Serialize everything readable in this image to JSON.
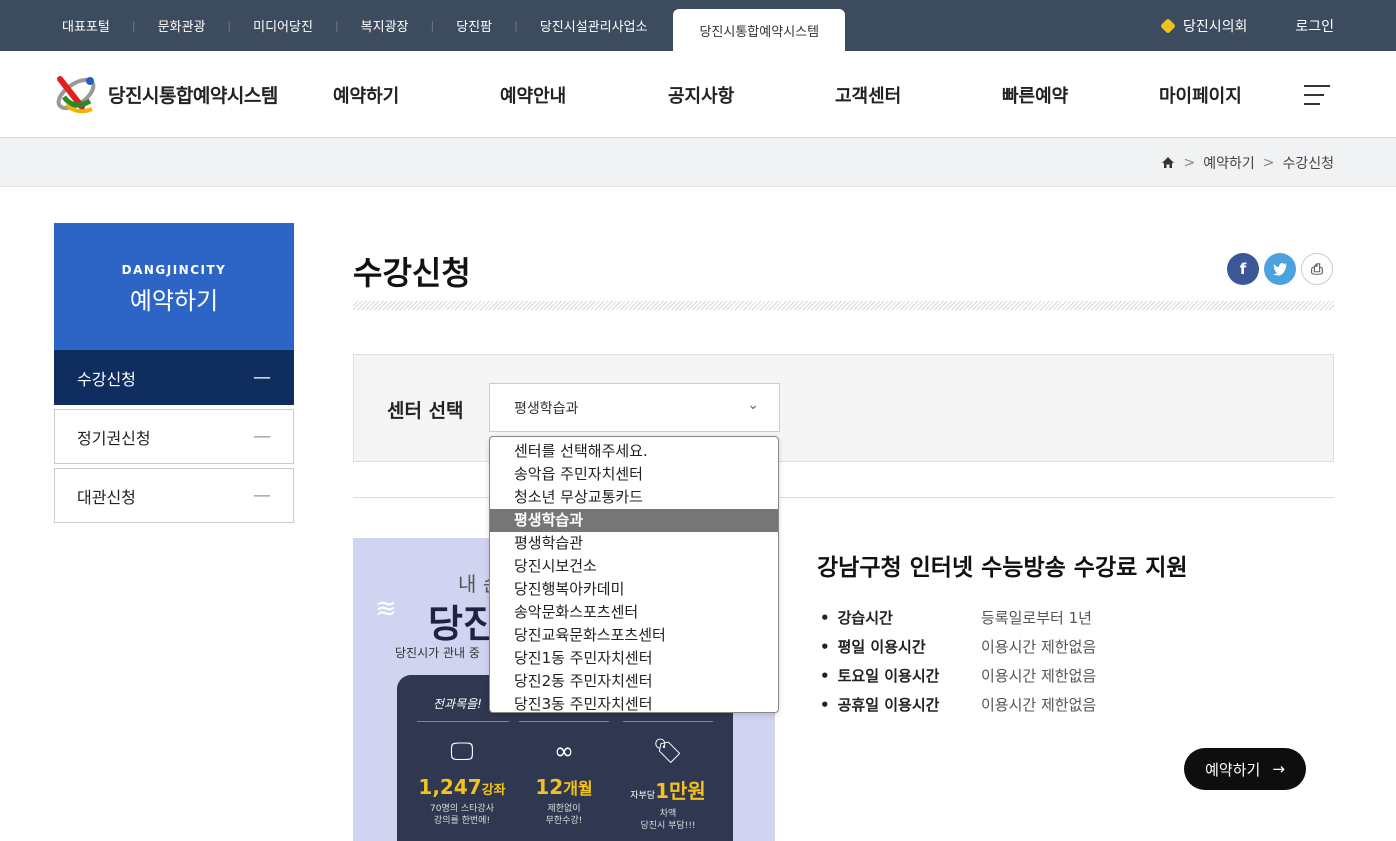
{
  "topbar": {
    "links": [
      "대표포털",
      "문화관광",
      "미디어당진",
      "복지광장",
      "당진팜",
      "당진시설관리사업소"
    ],
    "active_link": "당진시통합예약시스템",
    "council": "당진시의회",
    "login": "로그인"
  },
  "header": {
    "logo_text": "당진시통합예약시스템",
    "nav": [
      "예약하기",
      "예약안내",
      "공지사항",
      "고객센터",
      "빠른예약",
      "마이페이지"
    ]
  },
  "breadcrumb": {
    "items": [
      "예약하기",
      "수강신청"
    ]
  },
  "lnb": {
    "en": "DANGJINCITY",
    "title": "예약하기",
    "items": [
      {
        "label": "수강신청",
        "active": true
      },
      {
        "label": "정기권신청",
        "active": false
      },
      {
        "label": "대관신청",
        "active": false
      }
    ]
  },
  "page": {
    "title": "수강신청"
  },
  "sns": {
    "facebook": "f",
    "twitter": "t",
    "print": "⎙"
  },
  "center_select": {
    "label": "센터 선택",
    "value": "평생학습과",
    "options": [
      "센터를 선택해주세요.",
      "송악읍 주민자치센터",
      "청소년 무상교통카드",
      "평생학습과",
      "평생학습관",
      "당진시보건소",
      "당진행복아카데미",
      "송악문화스포츠센터",
      "당진교육문화스포츠센터",
      "당진1동 주민자치센터",
      "당진2동 주민자치센터",
      "당진3동 주민자치센터"
    ],
    "highlighted_index": 3
  },
  "banner": {
    "t1": "내 손",
    "t2": "당진",
    "t3": "당진시가 관내 중",
    "panel_head": "전과목을!",
    "stats": [
      {
        "num": "1,247",
        "unit": "강좌",
        "sub1": "70명의 스타강사",
        "sub2": "강의를 한번에!"
      },
      {
        "num": "12",
        "unit": "개월",
        "sub1": "제한없이",
        "sub2": "무한수강!"
      },
      {
        "num": "1만원",
        "unit": "",
        "pre": "자부담",
        "sub1": "차액",
        "sub2": "당진시 부담!!!"
      }
    ]
  },
  "course": {
    "title": "강남구청 인터넷 수능방송 수강료 지원",
    "rows": [
      {
        "k": "강습시간",
        "v": "등록일로부터 1년"
      },
      {
        "k": "평일 이용시간",
        "v": "이용시간 제한없음"
      },
      {
        "k": "토요일 이용시간",
        "v": "이용시간 제한없음"
      },
      {
        "k": "공휴일 이용시간",
        "v": "이용시간 제한없음"
      }
    ],
    "button": "예약하기",
    "button_arrow": "→"
  },
  "colors": {
    "topbar": "#3d4b5e",
    "lnb_head": "#2c65c6",
    "lnb_active": "#102d60",
    "dropdown_hl": "#767676"
  }
}
